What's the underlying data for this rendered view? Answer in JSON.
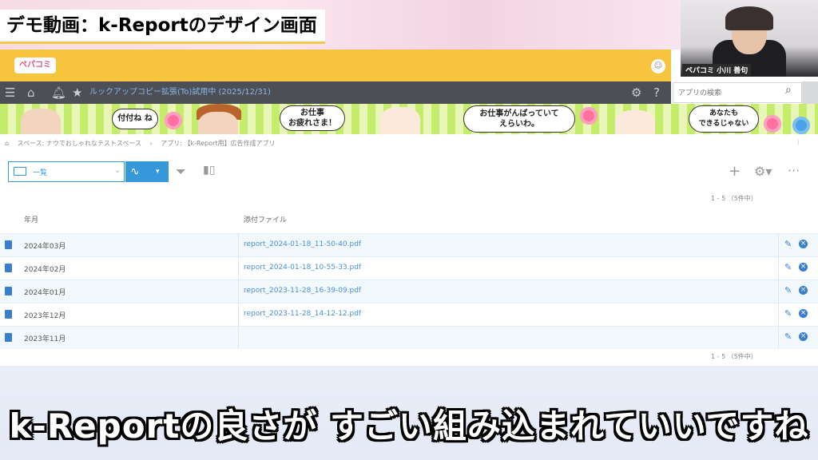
{
  "video": {
    "title": "デモ動画：k-Reportのデザイン画面",
    "subtitle": "k-Reportの良さが すごい組み込まれていいですね"
  },
  "webcam": {
    "name": "ペパコミ 小川 善句"
  },
  "header": {
    "logo": "ペパコミ",
    "app_title": "ルックアップコピー拡張(To)試用中 (2025/12/31)",
    "search_placeholder": "アプリの検索"
  },
  "banner": {
    "bubbles": [
      "付付ね ね",
      "お仕事\nお疲れさま！",
      "お仕事がんばっていて\nえらいわ。",
      "あなたも\nできるじゃない"
    ]
  },
  "breadcrumb": [
    "スペース: ナウでおしゃれなテストスペース",
    "アプリ: 【k-Report用】広告作成アプリ"
  ],
  "toolbar": {
    "view_label": "一覧"
  },
  "pager": {
    "text": "1 - 5 （5件中）"
  },
  "table": {
    "columns": [
      "年月",
      "添付ファイル"
    ],
    "rows": [
      {
        "month": "2024年03月",
        "file": "report_2024-01-18_11-50-40.pdf"
      },
      {
        "month": "2024年02月",
        "file": "report_2024-01-18_10-55-33.pdf"
      },
      {
        "month": "2024年01月",
        "file": "report_2023-11-28_16-39-09.pdf"
      },
      {
        "month": "2023年12月",
        "file": "report_2023-11-28_14-12-12.pdf"
      },
      {
        "month": "2023年11月",
        "file": ""
      }
    ]
  },
  "colors": {
    "accent": "#3498db",
    "yellow": "#f6c53d",
    "nav": "#4c4f56"
  }
}
